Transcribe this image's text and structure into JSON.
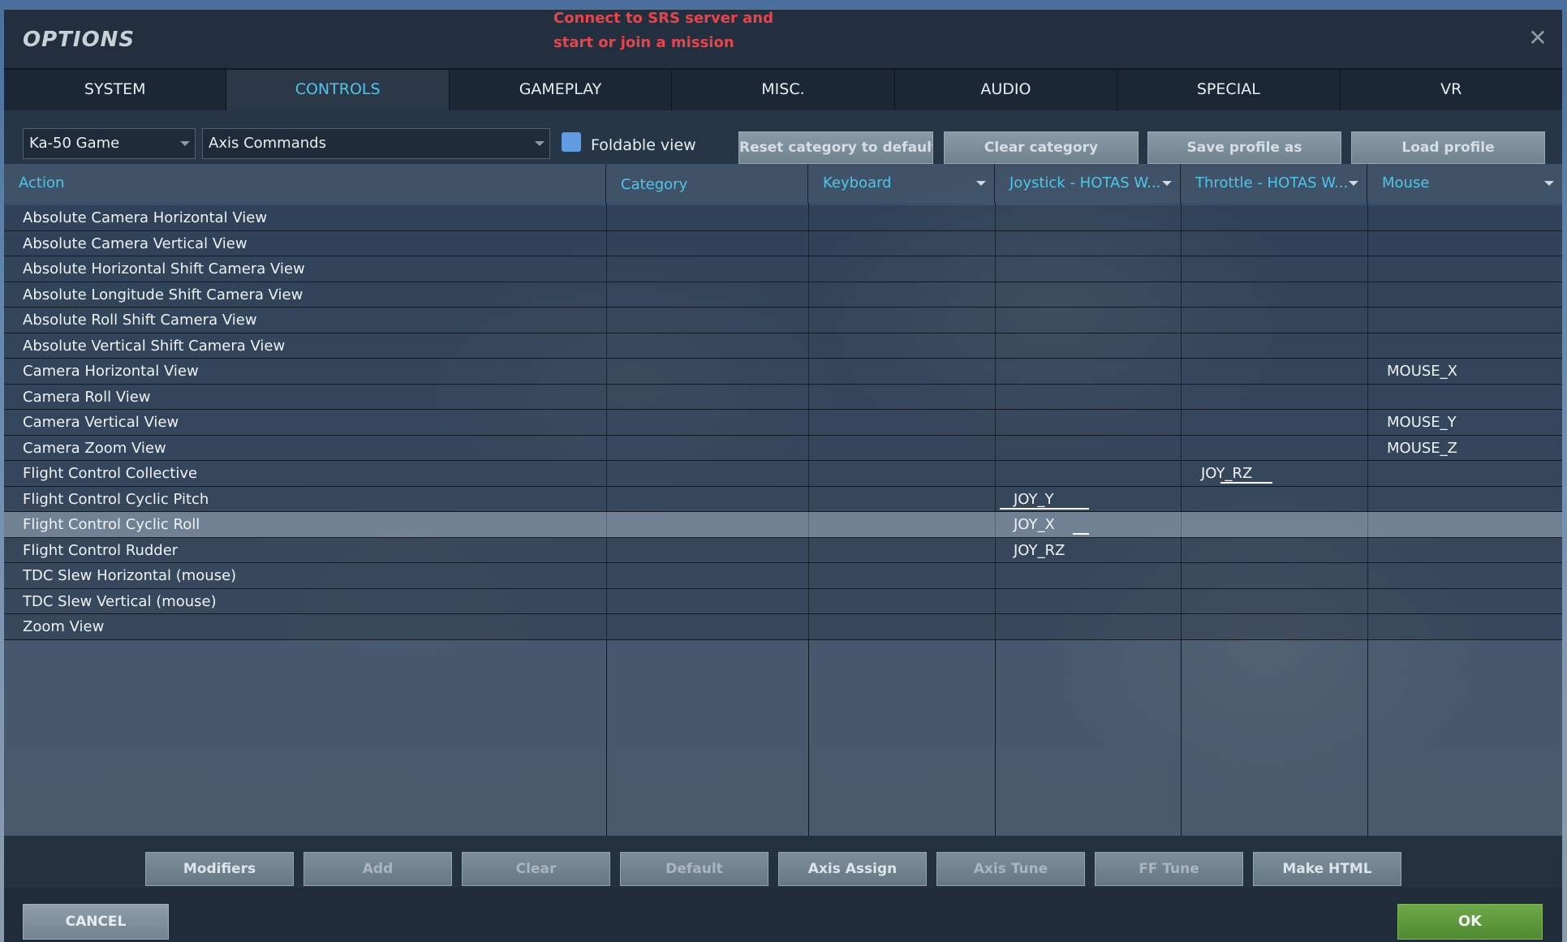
{
  "window": {
    "title": "OPTIONS",
    "srs_message_line1": "Connect to SRS server and",
    "srs_message_line2": "start or join a mission",
    "close_glyph": "✕"
  },
  "tabs": [
    {
      "label": "SYSTEM"
    },
    {
      "label": "CONTROLS",
      "active": true
    },
    {
      "label": "GAMEPLAY"
    },
    {
      "label": "MISC."
    },
    {
      "label": "AUDIO"
    },
    {
      "label": "SPECIAL"
    },
    {
      "label": "VR"
    }
  ],
  "toolbar": {
    "aircraft_select": "Ka-50 Game",
    "category_select": "Axis Commands",
    "foldable_view_label": "Foldable view",
    "foldable_view_checked": true,
    "reset_category_label": "Reset category to default",
    "clear_category_label": "Clear category",
    "save_profile_label": "Save profile as",
    "load_profile_label": "Load profile"
  },
  "table": {
    "headers": {
      "action": "Action",
      "category": "Category",
      "keyboard": "Keyboard",
      "joystick": "Joystick - HOTAS W...",
      "throttle": "Throttle - HOTAS W...",
      "mouse": "Mouse"
    },
    "rows": [
      {
        "action": "Absolute Camera Horizontal View",
        "joystick": "",
        "throttle": "",
        "mouse": ""
      },
      {
        "action": "Absolute Camera Vertical View",
        "joystick": "",
        "throttle": "",
        "mouse": ""
      },
      {
        "action": "Absolute Horizontal Shift Camera View",
        "joystick": "",
        "throttle": "",
        "mouse": ""
      },
      {
        "action": "Absolute Longitude Shift Camera View",
        "joystick": "",
        "throttle": "",
        "mouse": ""
      },
      {
        "action": "Absolute Roll Shift Camera View",
        "joystick": "",
        "throttle": "",
        "mouse": ""
      },
      {
        "action": "Absolute Vertical Shift Camera View",
        "joystick": "",
        "throttle": "",
        "mouse": ""
      },
      {
        "action": "Camera Horizontal View",
        "joystick": "",
        "throttle": "",
        "mouse": "MOUSE_X"
      },
      {
        "action": "Camera Roll View",
        "joystick": "",
        "throttle": "",
        "mouse": ""
      },
      {
        "action": "Camera Vertical View",
        "joystick": "",
        "throttle": "",
        "mouse": "MOUSE_Y"
      },
      {
        "action": "Camera Zoom View",
        "joystick": "",
        "throttle": "",
        "mouse": "MOUSE_Z"
      },
      {
        "action": "Flight Control Collective",
        "joystick": "",
        "throttle": "JOY_RZ",
        "mouse": ""
      },
      {
        "action": "Flight Control Cyclic Pitch",
        "joystick": "JOY_Y",
        "throttle": "",
        "mouse": ""
      },
      {
        "action": "Flight Control Cyclic Roll",
        "joystick": "JOY_X",
        "throttle": "",
        "mouse": "",
        "selected": true
      },
      {
        "action": "Flight Control Rudder",
        "joystick": "JOY_RZ",
        "throttle": "",
        "mouse": ""
      },
      {
        "action": "TDC Slew Horizontal (mouse)",
        "joystick": "",
        "throttle": "",
        "mouse": ""
      },
      {
        "action": "TDC Slew Vertical (mouse)",
        "joystick": "",
        "throttle": "",
        "mouse": ""
      },
      {
        "action": "Zoom View",
        "joystick": "",
        "throttle": "",
        "mouse": ""
      }
    ]
  },
  "bottom_buttons": {
    "modifiers": "Modifiers",
    "add": "Add",
    "clear": "Clear",
    "default": "Default",
    "axis_assign": "Axis Assign",
    "axis_tune": "Axis Tune",
    "ff_tune": "FF Tune",
    "make_html": "Make HTML"
  },
  "footer": {
    "cancel_label": "CANCEL",
    "ok_label": "OK"
  },
  "colors": {
    "accent": "#4fc6e8",
    "warning": "#e8444a",
    "ok_button": "#5d9a3a",
    "checkbox": "#5d9de0"
  }
}
